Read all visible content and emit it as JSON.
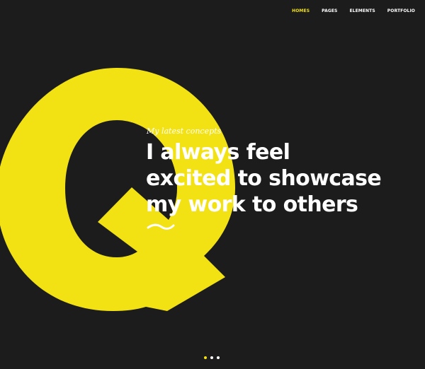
{
  "nav": {
    "items": [
      {
        "label": "HOMES",
        "active": true
      },
      {
        "label": "PAGES",
        "active": false
      },
      {
        "label": "ELEMENTS",
        "active": false
      },
      {
        "label": "PORTFOLIO",
        "active": false
      }
    ]
  },
  "hero": {
    "kicker": "My latest concepts",
    "title_lines": [
      "I always feel",
      "excited to showcase",
      "my work to others"
    ]
  },
  "decoration": {
    "letter": "Q",
    "squiggle_icon": "squiggle-underline-icon"
  },
  "slider": {
    "active_index": 0,
    "dot_count": 3
  },
  "colors": {
    "background": "#1c1c1c",
    "accent": "#f3e213",
    "text": "#ffffff"
  }
}
